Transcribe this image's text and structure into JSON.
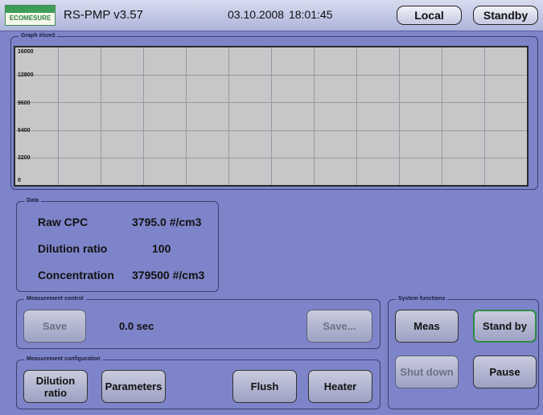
{
  "header": {
    "logo_text": "ECOMESURE",
    "app_title": "RS-PMP v3.57",
    "date": "03.10.2008",
    "time": "18:01:45",
    "local_button": "Local",
    "standby_button": "Standby"
  },
  "graph": {
    "label": "Graph #/cm3",
    "y_ticks": [
      "16000",
      "12800",
      "9600",
      "6400",
      "3200",
      "0"
    ]
  },
  "chart_data": {
    "type": "line",
    "ylabel": "Graph #/cm3",
    "ylim": [
      0,
      16000
    ],
    "y_ticks": [
      0,
      3200,
      6400,
      9600,
      12800,
      16000
    ],
    "grid": true,
    "series": []
  },
  "data_panel": {
    "label": "Data",
    "raw_cpc_label": "Raw CPC",
    "raw_cpc_value": "3795.0",
    "raw_cpc_unit": "#/cm3",
    "dilution_label": "Dilution ratio",
    "dilution_value": "100",
    "concentration_label": "Concentration",
    "concentration_value": "379500",
    "concentration_unit": "#/cm3"
  },
  "measurement_control": {
    "label": "Measurement control",
    "save_button": "Save",
    "elapsed": "0.0 sec",
    "save_as_button": "Save..."
  },
  "measurement_configuration": {
    "label": "Measurement configuration",
    "dilution_button_line1": "Dilution",
    "dilution_button_line2": "ratio",
    "parameters_button": "Parameters",
    "flush_button": "Flush",
    "heater_button": "Heater"
  },
  "system_functions": {
    "label": "System functions",
    "meas_button": "Meas",
    "standby_button": "Stand by",
    "shutdown_button": "Shut down",
    "pause_button": "Pause"
  },
  "colors": {
    "background": "#7e84c9",
    "plot_background": "#c7c7c9",
    "active_border": "#2e8b45",
    "logo_green": "#3e9d58"
  }
}
